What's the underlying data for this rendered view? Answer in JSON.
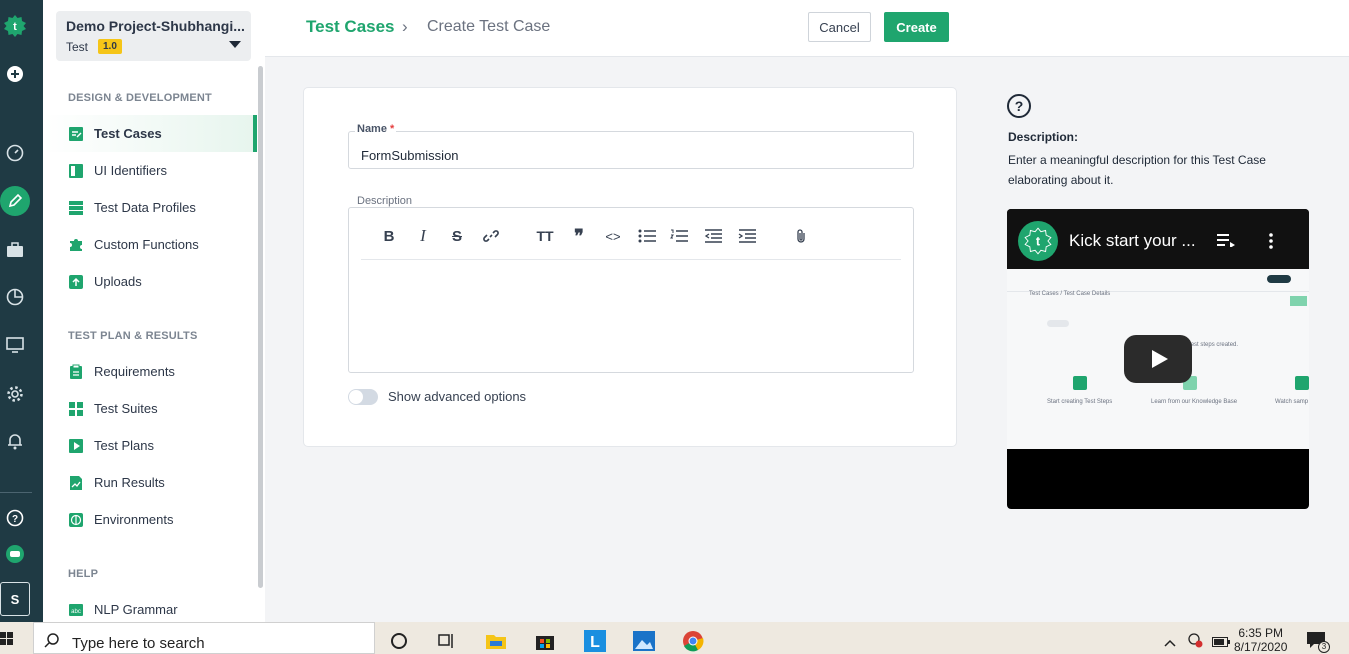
{
  "project": {
    "name": "Demo Project-Shubhangi...",
    "version_label": "Test",
    "version": "1.0"
  },
  "sidebar": {
    "sections": [
      {
        "title": "DESIGN & DEVELOPMENT",
        "items": [
          {
            "label": "Test Cases",
            "icon": "test-cases-icon",
            "active": true
          },
          {
            "label": "UI Identifiers",
            "icon": "ui-identifiers-icon"
          },
          {
            "label": "Test Data Profiles",
            "icon": "test-data-icon"
          },
          {
            "label": "Custom Functions",
            "icon": "puzzle-icon"
          },
          {
            "label": "Uploads",
            "icon": "upload-icon"
          }
        ]
      },
      {
        "title": "TEST PLAN & RESULTS",
        "items": [
          {
            "label": "Requirements",
            "icon": "clipboard-icon"
          },
          {
            "label": "Test Suites",
            "icon": "suites-icon"
          },
          {
            "label": "Test Plans",
            "icon": "play-icon"
          },
          {
            "label": "Run Results",
            "icon": "results-icon"
          },
          {
            "label": "Environments",
            "icon": "globe-icon"
          }
        ]
      },
      {
        "title": "HELP",
        "items": [
          {
            "label": "NLP Grammar",
            "icon": "abc-icon"
          }
        ]
      }
    ]
  },
  "rail": {
    "user_initial": "S"
  },
  "header": {
    "breadcrumb_root": "Test Cases",
    "breadcrumb_sep": "›",
    "breadcrumb_current": "Create Test Case",
    "cancel_label": "Cancel",
    "create_label": "Create"
  },
  "form": {
    "name_label": "Name",
    "name_required": "*",
    "name_value": "FormSubmission",
    "description_label": "Description",
    "toggle_label": "Show advanced options",
    "toggle_on": false
  },
  "help": {
    "icon": "?",
    "title": "Description:",
    "text": "Enter a meaningful description for this Test Case elaborating about it."
  },
  "video": {
    "title": "Kick start your ...",
    "frame_breadcrumb": "Test Cases  /  Test Case Details",
    "frame_empty": "There are no test steps created.",
    "col1": "Start creating Test Steps",
    "col2": "Learn from our Knowledge Base",
    "col3": "Watch samp"
  },
  "taskbar": {
    "search_placeholder": "Type here to search",
    "time": "6:35 PM",
    "date": "8/17/2020",
    "notif_count": "3"
  },
  "colors": {
    "accent": "#1fa56e",
    "rail": "#1f3a44"
  }
}
